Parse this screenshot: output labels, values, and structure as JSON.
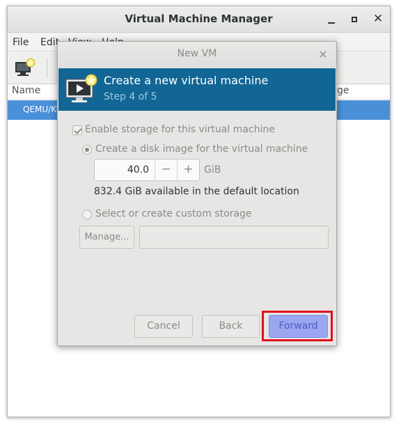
{
  "main_window": {
    "title": "Virtual Machine Manager",
    "menu": [
      "File",
      "Edit",
      "View",
      "Help"
    ],
    "columns": {
      "name": "Name",
      "usage": "ge"
    },
    "row_label": "QEMU/KV"
  },
  "dialog": {
    "title": "New VM",
    "close": "×",
    "header_title": "Create a new virtual machine",
    "header_subtitle": "Step 4 of 5",
    "enable_storage_label": "Enable storage for this virtual machine",
    "create_disk_label": "Create a disk image for the virtual machine",
    "disk_size": "40.0",
    "disk_unit": "GiB",
    "minus": "−",
    "plus": "+",
    "available_text": "832.4 GiB available in the default location",
    "custom_storage_label": "Select or create custom storage",
    "manage_button": "Manage...",
    "buttons": {
      "cancel": "Cancel",
      "back": "Back",
      "forward": "Forward"
    }
  },
  "colors": {
    "banner": "#116695",
    "selection": "#4a90d9",
    "forward_button": "#9aa7f0",
    "highlight": "#e0101e"
  }
}
